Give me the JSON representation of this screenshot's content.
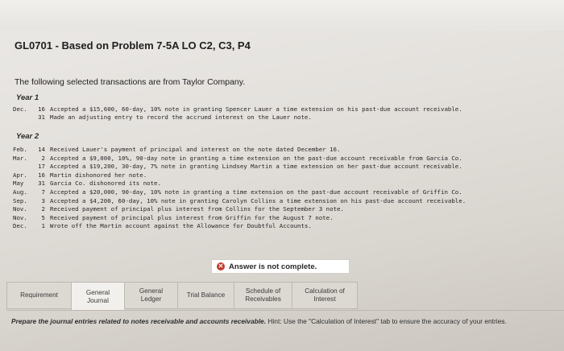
{
  "title": "GL0701 - Based on Problem 7-5A LO C2, C3, P4",
  "intro": "The following selected transactions are from Taylor Company.",
  "year1": {
    "label": "Year 1",
    "rows": [
      {
        "month": "Dec.",
        "day": "16",
        "text": "Accepted a $15,600, 60-day, 10% note in granting Spencer Lauer a time extension on his past-due account receivable."
      },
      {
        "month": "",
        "day": "31",
        "text": "Made an adjusting entry to record the accrued interest on the Lauer note."
      }
    ]
  },
  "year2": {
    "label": "Year 2",
    "rows": [
      {
        "month": "Feb.",
        "day": "14",
        "text": "Received Lauer's payment of principal and interest on the note dated December 16."
      },
      {
        "month": "Mar.",
        "day": "2",
        "text": "Accepted a $9,000, 10%, 90-day note in granting a time extension on the past-due account receivable from Garcia Co."
      },
      {
        "month": "",
        "day": "17",
        "text": "Accepted a $19,200, 30-day, 7% note in granting Lindsey Martin a time extension on her past-due account receivable."
      },
      {
        "month": "Apr.",
        "day": "16",
        "text": "Martin dishonored her note."
      },
      {
        "month": "May",
        "day": "31",
        "text": "Garcia Co. dishonored its note."
      },
      {
        "month": "Aug.",
        "day": "7",
        "text": "Accepted a $20,000, 90-day, 10% note in granting a time extension on the past-due account receivable of Griffin Co."
      },
      {
        "month": "Sep.",
        "day": "3",
        "text": "Accepted a $4,200, 60-day, 10% note in granting Carolyn Collins a time extension on his past-due account receivable."
      },
      {
        "month": "Nov.",
        "day": "2",
        "text": "Received payment of principal plus interest from Collins for the September 3 note."
      },
      {
        "month": "Nov.",
        "day": "5",
        "text": "Received payment of principal plus interest from Griffin for the August 7 note."
      },
      {
        "month": "Dec.",
        "day": "1",
        "text": "Wrote off the Martin account against the Allowance for Doubtful Accounts."
      }
    ]
  },
  "status": {
    "text": "Answer is not complete.",
    "icon": "x-circle-icon",
    "color": "#c3392b"
  },
  "tabs": [
    {
      "label": "Requirement",
      "active": false
    },
    {
      "label": "General\nJournal",
      "active": true
    },
    {
      "label": "General\nLedger",
      "active": false
    },
    {
      "label": "Trial Balance",
      "active": false
    },
    {
      "label": "Schedule of\nReceivables",
      "active": false
    },
    {
      "label": "Calculation of\nInterest",
      "active": false
    }
  ],
  "instructions": {
    "lead": "Prepare the journal entries related to notes receivable and accounts receivable.",
    "rest": "Hint: Use the \"Calculation of Interest\" tab to ensure the accuracy of your entries."
  }
}
